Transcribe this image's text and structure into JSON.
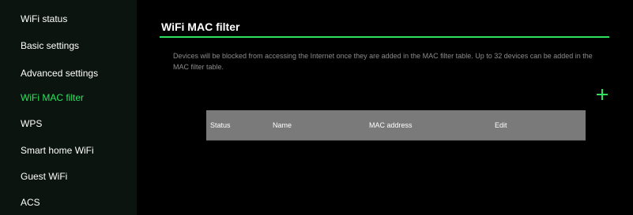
{
  "sidebar": {
    "items": [
      {
        "label": "WiFi status",
        "active": false
      },
      {
        "label": "Basic settings",
        "active": false
      },
      {
        "label": "Advanced settings",
        "active": false
      },
      {
        "label": "WiFi MAC filter",
        "active": true
      },
      {
        "label": "WPS",
        "active": false
      },
      {
        "label": "Smart home WiFi",
        "active": false
      },
      {
        "label": "Guest WiFi",
        "active": false
      },
      {
        "label": "ACS",
        "active": false
      }
    ]
  },
  "main": {
    "title": "WiFi MAC filter",
    "description": "Devices will be blocked from accessing the Internet once they are added in the MAC filter table. Up to 32 devices can be added in the MAC filter table.",
    "add_icon": "plus-icon",
    "table": {
      "columns": [
        "Status",
        "Name",
        "MAC address",
        "Edit"
      ],
      "rows": []
    }
  },
  "colors": {
    "accent": "#2ee25f",
    "sidebar_bg": "#0b140f",
    "main_bg": "#000000",
    "table_header_bg": "#7a7a7a",
    "description_text": "#8c8c8c"
  }
}
